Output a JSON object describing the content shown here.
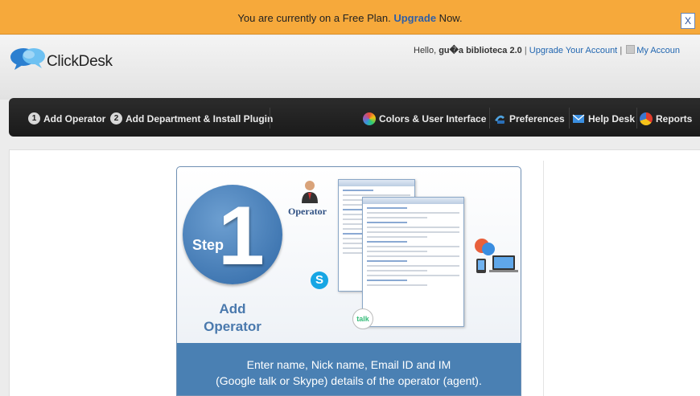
{
  "banner": {
    "text_before": "You are currently on a Free Plan. ",
    "upgrade_link": "Upgrade",
    "text_after": " Now.",
    "close_label": "X"
  },
  "header": {
    "logo_text": "ClickDesk",
    "greeting": "Hello, ",
    "username": "gu�a biblioteca 2.0",
    "upgrade_account": "Upgrade Your Account",
    "my_account": "My Accoun"
  },
  "nav": {
    "left": [
      {
        "num": "1",
        "label": "Add Operator"
      },
      {
        "num": "2",
        "label": "Add Department & Install Plugin"
      }
    ],
    "right": [
      {
        "icon": "colors-icon",
        "label": "Colors & User Interface"
      },
      {
        "icon": "preferences-icon",
        "label": "Preferences"
      },
      {
        "icon": "helpdesk-icon",
        "label": "Help Desk"
      },
      {
        "icon": "reports-icon",
        "label": "Reports"
      }
    ]
  },
  "step": {
    "word": "Step",
    "number": "1",
    "title_line1": "Add",
    "title_line2": "Operator",
    "operator_label": "Operator",
    "talk_label": "talk",
    "skype_label": "S",
    "caption_line1": "Enter name, Nick name, Email ID and IM",
    "caption_line2": "(Google talk or Skype) details of the operator (agent)."
  },
  "colors": {
    "banner": "#f6a93b",
    "link": "#2166b0",
    "navbar": "#1f1f1f",
    "step_blue": "#2f68a6",
    "caption_bg": "#4a80b3"
  }
}
